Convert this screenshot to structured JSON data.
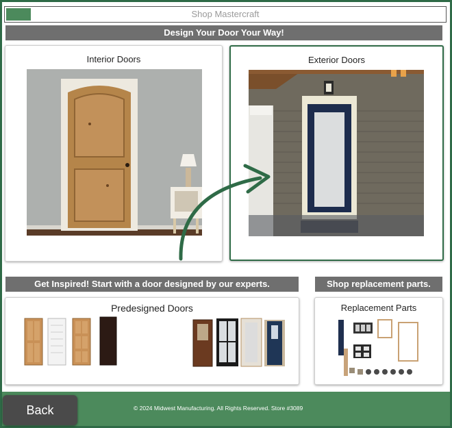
{
  "header": {
    "title": "Shop Mastercraft"
  },
  "main_banner": "Design Your Door Your Way!",
  "door_types": [
    {
      "label": "Interior Doors",
      "image": "interior-door-photo",
      "selected": false
    },
    {
      "label": "Exterior Doors",
      "image": "exterior-door-photo",
      "selected": true
    }
  ],
  "inspire_banner": "Get Inspired! Start with a door designed by our experts.",
  "parts_banner": "Shop replacement parts.",
  "predesigned": {
    "label": "Predesigned Doors"
  },
  "replacement": {
    "label": "Replacement Parts"
  },
  "footer": {
    "back_label": "Back",
    "copyright": "© 2024 Midwest Manufacturing. All Rights Reserved. Store #3089"
  },
  "colors": {
    "brand_green": "#4c8a5c",
    "frame_green": "#2f6b47",
    "banner_gray": "#6f6f6f"
  },
  "icons": [
    "curved-arrow-icon"
  ]
}
